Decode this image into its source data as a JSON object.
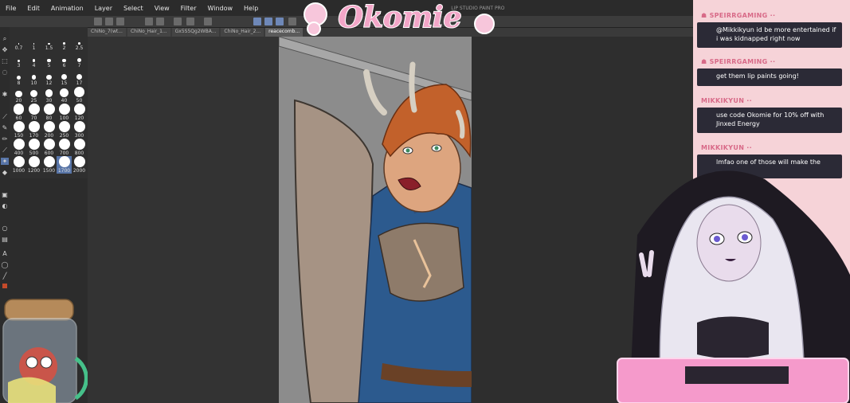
{
  "menubar": {
    "items": [
      "File",
      "Edit",
      "Animation",
      "Layer",
      "Select",
      "View",
      "Filter",
      "Window",
      "Help"
    ],
    "title": "LIP STUDIO PAINT PRO"
  },
  "tabs": [
    "ChiNo_7(wt...",
    "ChiNo_Hair_1...",
    "Gx5S5Qg2WBA...",
    "ChiNo_Hair_2...",
    "reacecomb..."
  ],
  "brush_sizes": {
    "rows": [
      [
        "0.7",
        "1",
        "1.5",
        "2",
        "2.5"
      ],
      [
        "3",
        "4",
        "5",
        "6",
        "7"
      ],
      [
        "8",
        "10",
        "12",
        "15",
        "17"
      ],
      [
        "20",
        "25",
        "30",
        "40",
        "50"
      ],
      [
        "60",
        "70",
        "80",
        "100",
        "120"
      ],
      [
        "150",
        "170",
        "200",
        "250",
        "300"
      ],
      [
        "400",
        "500",
        "600",
        "700",
        "800"
      ],
      [
        "1000",
        "1200",
        "1500",
        "1700",
        "2000"
      ]
    ],
    "selected": "1700"
  },
  "logo": {
    "text": "Okomie"
  },
  "chat": [
    {
      "user": "SPEIRRGAMING",
      "message": "@Mikkikyun id be more entertained if i was kidnapped right now"
    },
    {
      "user": "SPEIRRGAMING",
      "message": "get them lip paints going!"
    },
    {
      "user": "MIKKIKYUN",
      "message": "use code Okomie for 10% off with Jinxed Energy"
    },
    {
      "user": "MIKKIKYUN",
      "message": "lmfao one of those will make the"
    }
  ],
  "colors": {
    "chat_bg": "#f6d3d8",
    "chat_box": "#2b2a36",
    "chat_user": "#d86a88",
    "logo_pink": "#f3a6c8"
  }
}
